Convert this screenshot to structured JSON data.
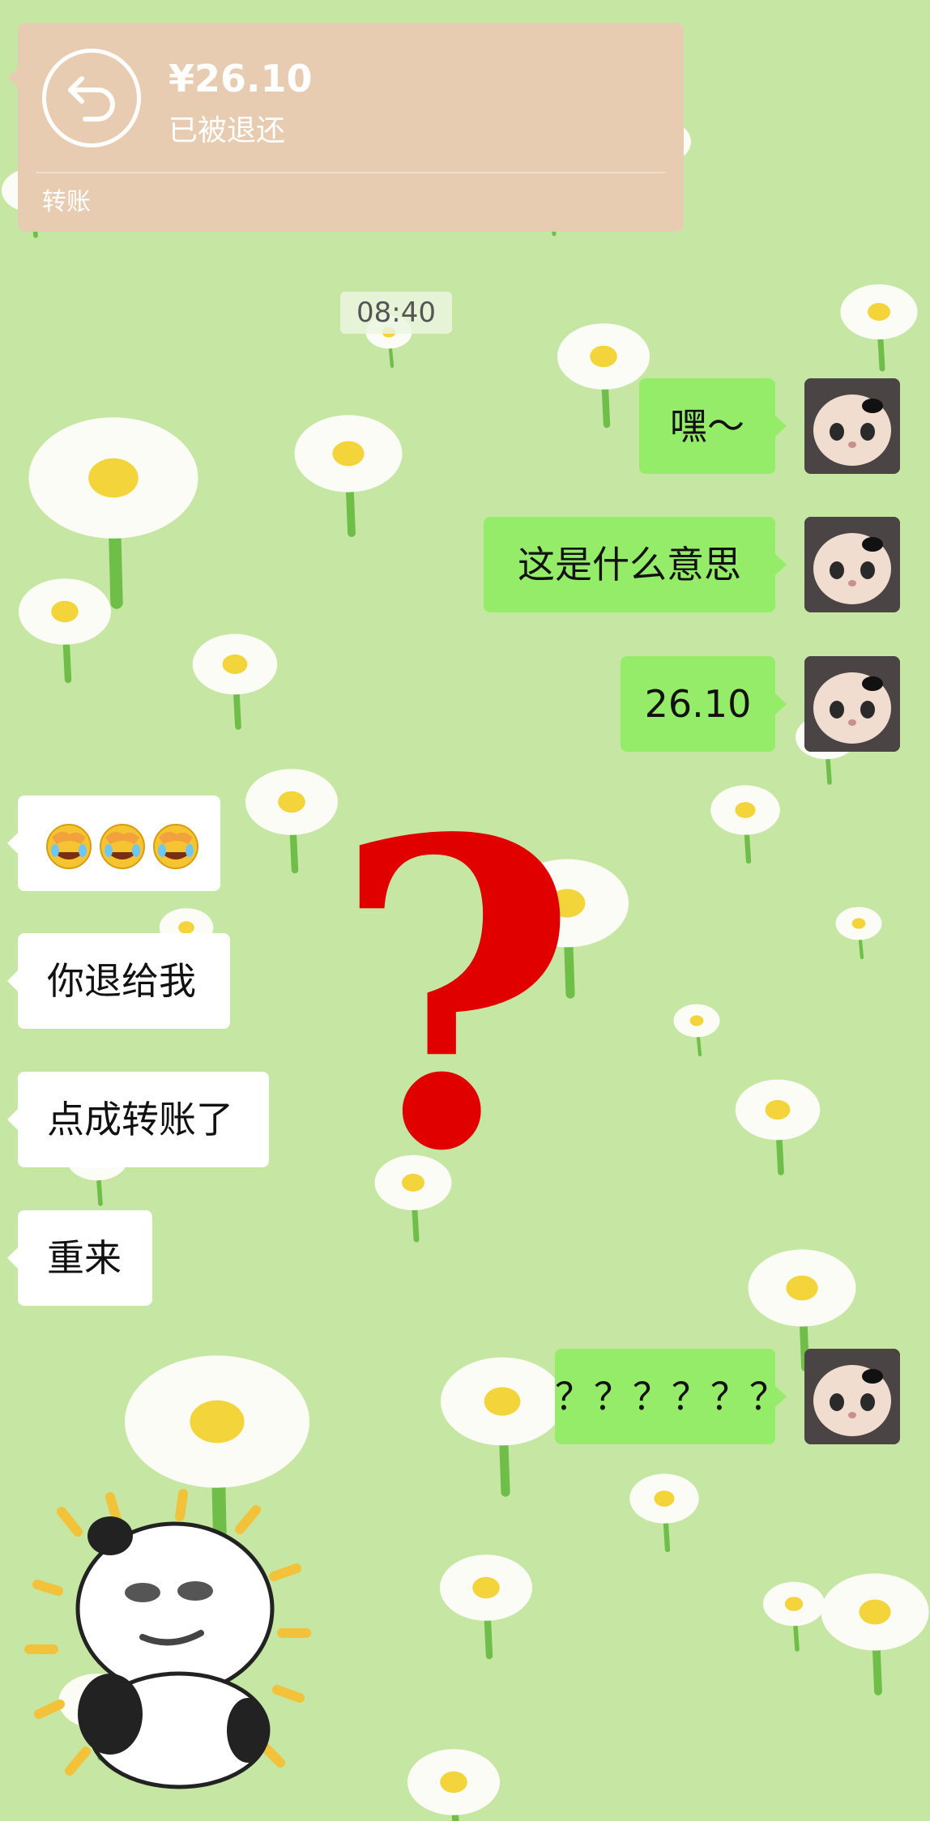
{
  "transfer": {
    "amount": "¥26.10",
    "status": "已被退还",
    "label": "转账",
    "icon": "return-arrow-icon"
  },
  "timestamp": "08:40",
  "messages": [
    {
      "side": "out",
      "text": "嘿～"
    },
    {
      "side": "out",
      "text": "这是什么意思"
    },
    {
      "side": "out",
      "text": "26.10"
    },
    {
      "side": "in",
      "emoji": [
        "facepalm-laughing-emoji",
        "facepalm-laughing-emoji",
        "facepalm-laughing-emoji"
      ]
    },
    {
      "side": "in",
      "text": "你退给我"
    },
    {
      "side": "in",
      "text": "点成转账了"
    },
    {
      "side": "in",
      "text": "重来"
    },
    {
      "side": "out",
      "text": "？？？？？？"
    }
  ],
  "overlay": {
    "symbol": "?",
    "color": "#e00000"
  },
  "sticker": {
    "name": "panda-meme-sticker"
  },
  "colors": {
    "background": "#c8e8a4",
    "outgoing_bubble": "#95ec69",
    "incoming_bubble": "#ffffff",
    "transfer_card": "#e8ccb1"
  }
}
